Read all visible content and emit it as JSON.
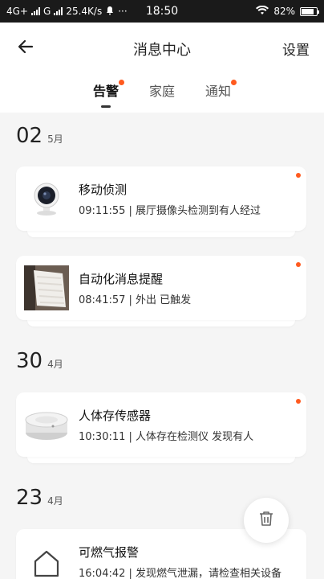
{
  "status_bar": {
    "network": "4G+",
    "network2": "G",
    "speed": "25.4K/s",
    "more": "···",
    "time": "18:50",
    "battery": "82%",
    "battery_level": 0.82
  },
  "header": {
    "title": "消息中心",
    "settings_label": "设置"
  },
  "tabs": [
    {
      "label": "告警",
      "active": true,
      "unread": true
    },
    {
      "label": "家庭",
      "active": false,
      "unread": false
    },
    {
      "label": "通知",
      "active": false,
      "unread": true
    }
  ],
  "groups": [
    {
      "day": "02",
      "month": "5月",
      "items": [
        {
          "title": "移动侦测",
          "desc": "09:11:55 | 展厅摄像头检测到有人经过",
          "icon": "camera-thumbnail",
          "unread": true
        },
        {
          "title": "自动化消息提醒",
          "desc": "08:41:57 | 外出 已触发",
          "icon": "photo-thumbnail",
          "unread": true
        }
      ]
    },
    {
      "day": "30",
      "month": "4月",
      "items": [
        {
          "title": "人体存传感器",
          "desc": "10:30:11 | 人体存在检测仪 发现有人",
          "icon": "presence-sensor-thumbnail",
          "unread": true
        }
      ]
    },
    {
      "day": "23",
      "month": "4月",
      "items": [
        {
          "title": "可燃气报警",
          "desc": "16:04:42 | 发现燃气泄漏，请检查相关设备",
          "icon": "home-icon",
          "unread": false
        }
      ]
    }
  ],
  "icons": {
    "back": "back-arrow-icon",
    "delete": "trash-icon"
  },
  "colors": {
    "accent": "#ff5a1f",
    "background": "#f5f5f5"
  }
}
